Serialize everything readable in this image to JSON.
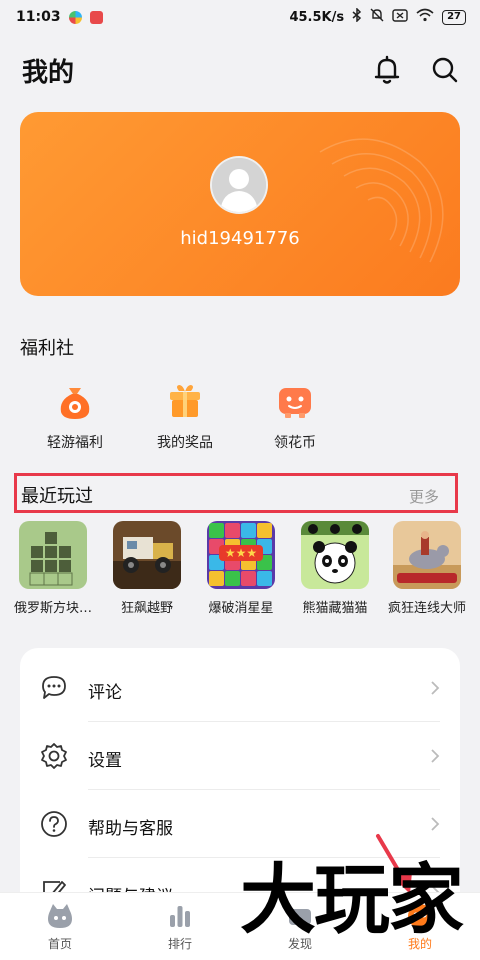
{
  "status_bar": {
    "time": "11:03",
    "network_speed": "45.5K/s",
    "battery": "27"
  },
  "header": {
    "title": "我的"
  },
  "profile": {
    "username": "hid19491776"
  },
  "welfare": {
    "title": "福利社",
    "items": [
      {
        "label": "轻游福利",
        "icon": "money-bag-icon"
      },
      {
        "label": "我的奖品",
        "icon": "gift-icon"
      },
      {
        "label": "领花币",
        "icon": "gamepad-coin-icon"
      }
    ]
  },
  "recent": {
    "title": "最近玩过",
    "more_label": "更多",
    "games": [
      {
        "name": "俄罗斯方块…"
      },
      {
        "name": "狂飙越野"
      },
      {
        "name": "爆破消星星"
      },
      {
        "name": "熊猫藏猫猫"
      },
      {
        "name": "疯狂连线大师"
      }
    ]
  },
  "menu": {
    "items": [
      {
        "label": "评论",
        "icon": "comment-icon"
      },
      {
        "label": "设置",
        "icon": "gear-icon"
      },
      {
        "label": "帮助与客服",
        "icon": "help-icon"
      },
      {
        "label": "问题与建议",
        "icon": "feedback-icon"
      }
    ]
  },
  "bottom_nav": {
    "items": [
      {
        "label": "首页"
      },
      {
        "label": "排行"
      },
      {
        "label": "发现"
      },
      {
        "label": "我的"
      }
    ],
    "active_index": 3
  },
  "watermark": {
    "text": "大玩家"
  },
  "colors": {
    "accent": "#ff7a1a",
    "highlight_border": "#e8394a",
    "background": "#f2f2f4"
  }
}
